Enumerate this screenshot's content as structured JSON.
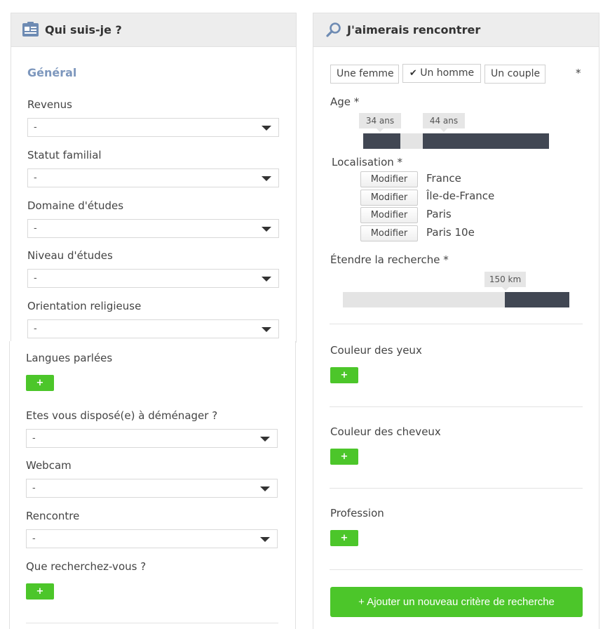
{
  "about": {
    "title": "Qui suis-je ?",
    "section": "Général",
    "fields": [
      {
        "label": "Revenus",
        "value": "-"
      },
      {
        "label": "Statut familial",
        "value": "-"
      },
      {
        "label": "Domaine d'études",
        "value": "-"
      },
      {
        "label": "Niveau d'études",
        "value": "-"
      },
      {
        "label": "Orientation religieuse",
        "value": "-"
      }
    ],
    "languages_label": "Langues parlées",
    "languages_add": "+",
    "fields2": [
      {
        "label": "Etes vous disposé(e) à déménager ?",
        "value": "-"
      },
      {
        "label": "Webcam",
        "value": "-"
      },
      {
        "label": "Rencontre",
        "value": "-"
      }
    ],
    "looking_label": "Que recherchez-vous ?",
    "looking_add": "+"
  },
  "meet": {
    "title": "J'aimerais rencontrer",
    "gender_options": [
      {
        "label": "Une femme",
        "selected": false
      },
      {
        "label": "Un homme",
        "selected": true
      },
      {
        "label": "Un couple",
        "selected": false
      }
    ],
    "check_mark": "✔",
    "required_mark": "*",
    "age_label": "Age *",
    "age_min": "34 ans",
    "age_max": "44 ans",
    "location_label": "Localisation *",
    "modify_label": "Modifier",
    "locations": [
      "France",
      "Île-de-France",
      "Paris",
      "Paris 10e"
    ],
    "extend_label": "Étendre la recherche *",
    "extend_value": "150 km",
    "criteria": [
      {
        "label": "Couleur des yeux",
        "add": "+"
      },
      {
        "label": "Couleur des cheveux",
        "add": "+"
      },
      {
        "label": "Profession",
        "add": "+"
      }
    ],
    "add_criterion": "+ Ajouter un nouveau critère de recherche"
  },
  "icons": {
    "about": "id-card-icon",
    "meet": "search-icon"
  },
  "colors": {
    "accent_green": "#4cc62a",
    "slider_dark": "#414753",
    "section_blue": "#7d97bd"
  }
}
